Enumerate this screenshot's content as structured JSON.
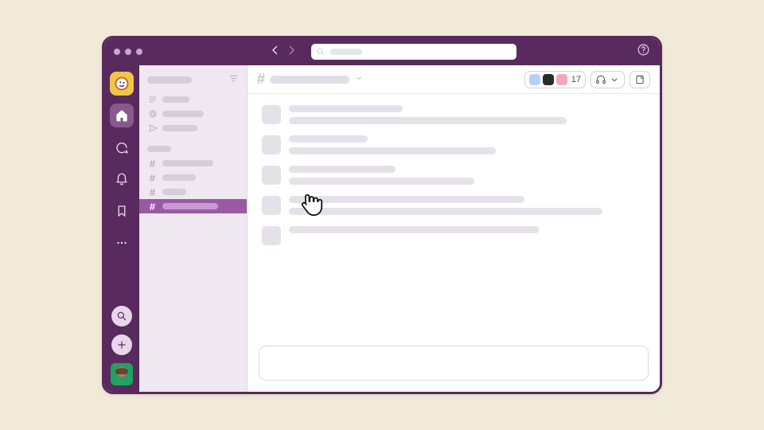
{
  "channel_header": {
    "hash": "#",
    "member_count": "17"
  },
  "sidebar": {
    "hash": "#"
  },
  "colors": {
    "member_avatar_1": "#b9d0f5",
    "member_avatar_2": "#2b2b2b",
    "member_avatar_3": "#f6a8b8"
  }
}
